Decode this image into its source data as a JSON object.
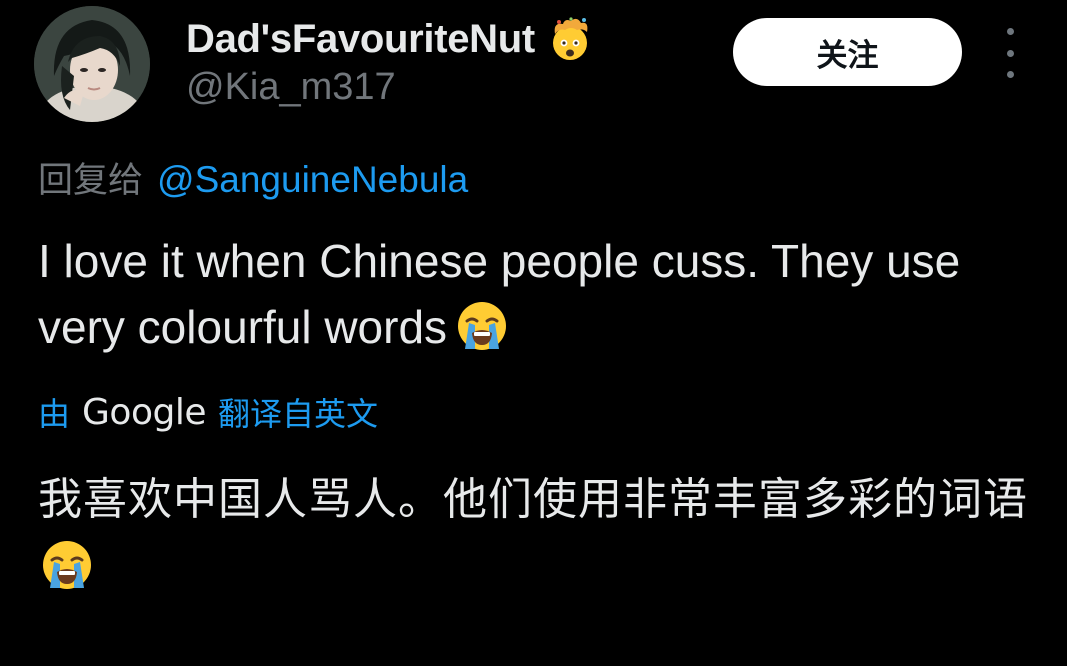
{
  "author": {
    "display_name": "Dad'sFavouriteNut",
    "name_emoji": "exploding-head-emoji",
    "handle": "@Kia_m317"
  },
  "actions": {
    "follow_label": "关注",
    "more_icon": "more-vertical-icon"
  },
  "reply": {
    "prefix": "回复给",
    "mention": "@SanguineNebula"
  },
  "tweet": {
    "text": "I love it when Chinese people cuss. They use very colourful words",
    "emoji": "loudly-crying-face-emoji"
  },
  "translation": {
    "by_label": "由",
    "provider": "Google",
    "from_label": "翻译自英文",
    "text": "我喜欢中国人骂人。他们使用非常丰富多彩的词语",
    "emoji": "loudly-crying-face-emoji"
  },
  "colors": {
    "background": "#000000",
    "primary_text": "#e7e9ea",
    "secondary_text": "#71767b",
    "link": "#1d9bf0",
    "follow_button_bg": "#ffffff"
  }
}
